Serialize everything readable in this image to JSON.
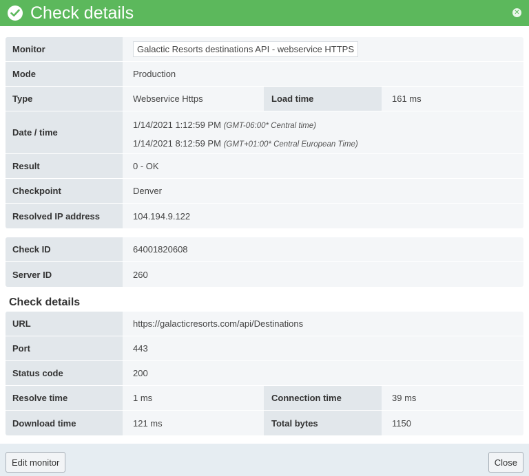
{
  "dialog": {
    "title": "Check details",
    "close_icon": "close-icon",
    "title_icon": "check-circle-icon",
    "accent_color": "#5cb85c"
  },
  "monitor_info": {
    "monitor_label": "Monitor",
    "monitor_value": "Galactic Resorts destinations API - webservice HTTPS",
    "mode_label": "Mode",
    "mode_value": "Production",
    "type_label": "Type",
    "type_value": "Webservice Https",
    "load_time_label": "Load time",
    "load_time_value": "161 ms",
    "datetime_label": "Date / time",
    "datetime_line1": "1/14/2021 1:12:59 PM",
    "datetime_line1_tz": "(GMT-06:00* Central time)",
    "datetime_line2": "1/14/2021 8:12:59 PM",
    "datetime_line2_tz": "(GMT+01:00* Central European Time)",
    "result_label": "Result",
    "result_value": "0 - OK",
    "checkpoint_label": "Checkpoint",
    "checkpoint_value": "Denver",
    "resolved_ip_label": "Resolved IP address",
    "resolved_ip_value": "104.194.9.122"
  },
  "ids": {
    "check_id_label": "Check ID",
    "check_id_value": "64001820608",
    "server_id_label": "Server ID",
    "server_id_value": "260"
  },
  "check_details": {
    "section_title": "Check details",
    "url_label": "URL",
    "url_value": "https://galacticresorts.com/api/Destinations",
    "port_label": "Port",
    "port_value": "443",
    "status_code_label": "Status code",
    "status_code_value": "200",
    "resolve_time_label": "Resolve time",
    "resolve_time_value": "1 ms",
    "connection_time_label": "Connection time",
    "connection_time_value": "39 ms",
    "download_time_label": "Download time",
    "download_time_value": "121 ms",
    "total_bytes_label": "Total bytes",
    "total_bytes_value": "1150"
  },
  "footer": {
    "edit_monitor_label": "Edit monitor",
    "close_label": "Close"
  }
}
